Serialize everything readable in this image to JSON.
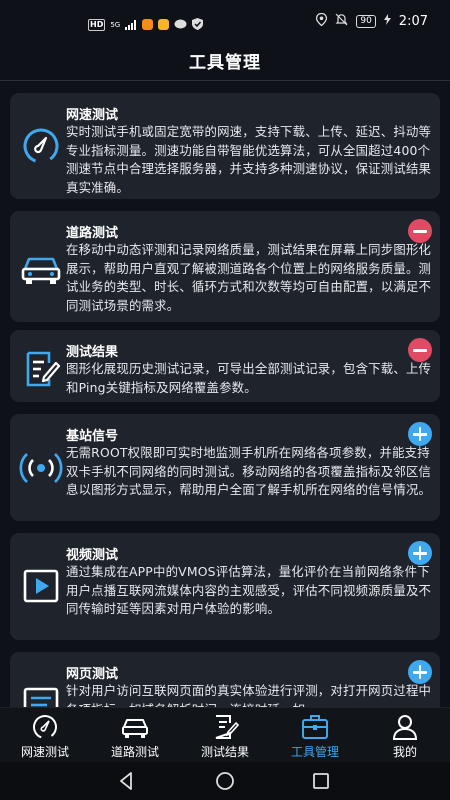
{
  "status": {
    "hd": "HD",
    "signal": "5G",
    "battery": "90",
    "time": "2:07"
  },
  "header": {
    "title": "工具管理"
  },
  "cards": [
    {
      "title": "网速测试",
      "desc": "实时测试手机或固定宽带的网速，支持下载、上传、延迟、抖动等专业指标测量。测速功能自带智能优选算法，可从全国超过400个测速节点中合理选择服务器，并支持多种测速协议，保证测试结果真实准确。",
      "icon": "speedometer-icon",
      "action": "none"
    },
    {
      "title": "道路测试",
      "desc": "在移动中动态评测和记录网络质量，测试结果在屏幕上同步图形化展示，帮助用户直观了解被测道路各个位置上的网络服务质量。测试业务的类型、时长、循环方式和次数等均可自由配置，以满足不同测试场景的需求。",
      "icon": "car-icon",
      "action": "remove"
    },
    {
      "title": "测试结果",
      "desc": "图形化展现历史测试记录，可导出全部测试记录，包含下载、上传和Ping关键指标及网络覆盖参数。",
      "icon": "report-icon",
      "action": "remove"
    },
    {
      "title": "基站信号",
      "desc": "无需ROOT权限即可实时地监测手机所在网络各项参数，并能支持双卡手机不同网络的同时测试。移动网络的各项覆盖指标及邻区信息以图形方式显示，帮助用户全面了解手机所在网络的信号情况。",
      "icon": "signal-icon",
      "action": "add"
    },
    {
      "title": "视频测试",
      "desc": "通过集成在APP中的VMOS评估算法，量化评价在当前网络条件下用户点播互联网流媒体内容的主观感受，评估不同视频源质量及不同传输时延等因素对用户体验的影响。",
      "icon": "video-play-icon",
      "action": "add"
    },
    {
      "title": "网页测试",
      "desc": "针对用户访问互联网页面的真实体验进行评测，对打开网页过程中各项指标，如域名解析时间、连接时延、如",
      "icon": "web-icon",
      "action": "add"
    }
  ],
  "nav": [
    {
      "label": "网速测试",
      "icon": "speedometer-icon"
    },
    {
      "label": "道路测试",
      "icon": "car-icon"
    },
    {
      "label": "测试结果",
      "icon": "report-icon"
    },
    {
      "label": "工具管理",
      "icon": "toolbox-icon"
    },
    {
      "label": "我的",
      "icon": "user-icon"
    }
  ],
  "active_nav": 3,
  "colors": {
    "accent": "#3fa8ef",
    "remove": "#e04a62",
    "card": "#1f242c",
    "background": "#0e1117"
  }
}
